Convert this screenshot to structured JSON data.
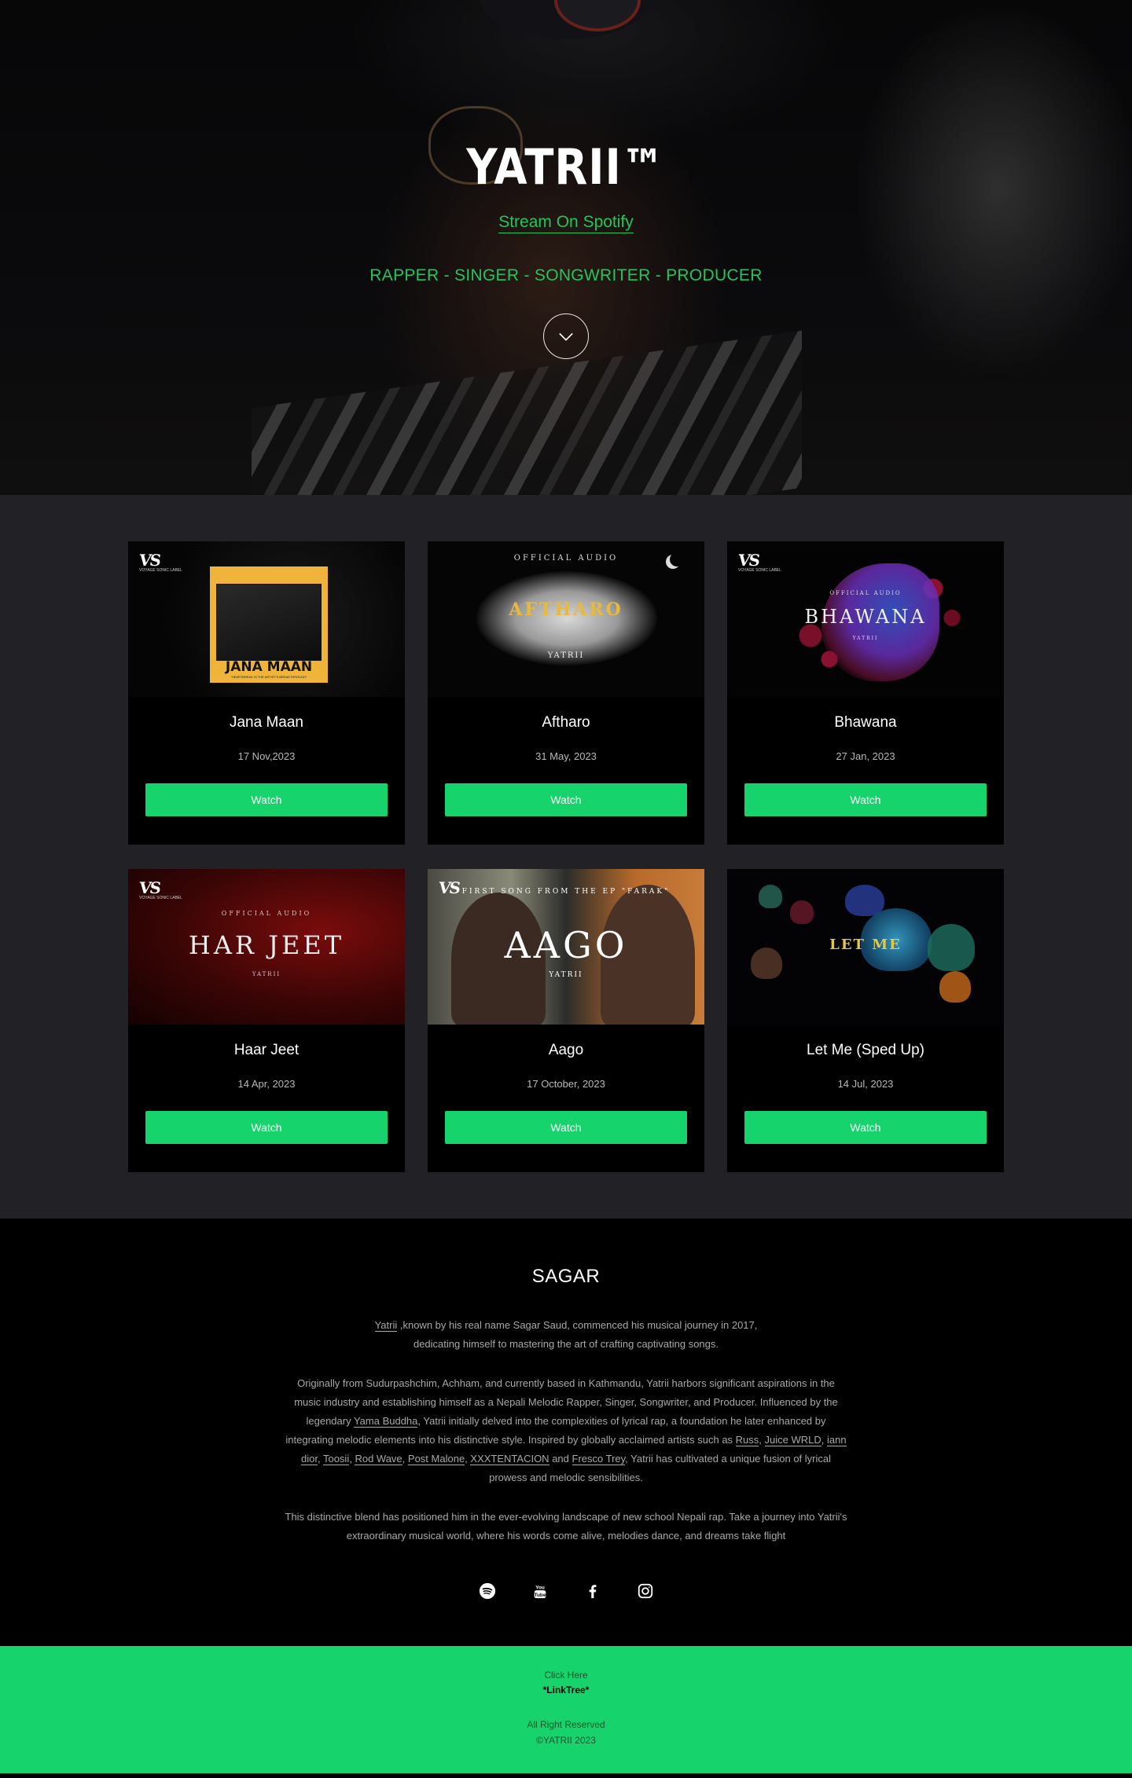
{
  "hero": {
    "title": "YATRII™",
    "spotify_link": "Stream On Spotify",
    "roles": "RAPPER - SINGER - SONGWRITER - PRODUCER",
    "scroll_icon": "chevron-down-icon"
  },
  "cards": [
    {
      "title": "Jana Maan",
      "date": "17 Nov,2023",
      "button": "Watch",
      "thumb": {
        "logo": "VS",
        "logo_sub": "VOYAGE SONIC LABEL",
        "poster_title": "JANA MAAN",
        "poster_caption": "\"HEARTBREAK IS THE ARTIST'S BREAKTHROUGH\""
      }
    },
    {
      "title": "Aftharo",
      "date": "31 May, 2023",
      "button": "Watch",
      "thumb": {
        "overline": "OFFICIAL AUDIO",
        "title": "AFTHARO",
        "artist": "YATRII"
      }
    },
    {
      "title": "Bhawana",
      "date": "27 Jan, 2023",
      "button": "Watch",
      "thumb": {
        "logo": "VS",
        "logo_sub": "VOYAGE SONIC LABEL",
        "overline": "OFFICIAL AUDIO",
        "title": "BHAWANA",
        "artist": "YATRII"
      }
    },
    {
      "title": "Haar Jeet",
      "date": "14 Apr, 2023",
      "button": "Watch",
      "thumb": {
        "logo": "VS",
        "logo_sub": "VOYAGE SONIC LABEL",
        "overline": "OFFICIAL AUDIO",
        "title": "HAR JEET",
        "artist": "YATRII"
      }
    },
    {
      "title": "Aago",
      "date": "17 October, 2023",
      "button": "Watch",
      "thumb": {
        "logo": "VS",
        "overline": "FIRST SONG FROM THE EP \"FARAK\"",
        "title": "AAGO",
        "artist": "YATRII"
      }
    },
    {
      "title": "Let Me (Sped Up)",
      "date": "14 Jul, 2023",
      "button": "Watch",
      "thumb": {
        "title": "LET ME"
      }
    }
  ],
  "about": {
    "title": "SAGAR",
    "p1_link": "Yatrii",
    "p1_rest": " ,known by his real name Sagar Saud, commenced his musical journey in 2017, dedicating himself to mastering the art of crafting captivating songs.",
    "p2_a": "Originally from Sudurpashchim, Achham, and currently based in Kathmandu, Yatrii harbors significant aspirations in the music industry and establishing himself as a Nepali Melodic Rapper, Singer, Songwriter, and Producer. Influenced by the legendary ",
    "p2_link1": "Yama Buddha",
    "p2_b": ", Yatrii initially delved into the complexities of lyrical rap, a foundation he later enhanced by integrating melodic elements into his distinctive style. Inspired by globally acclaimed artists such as ",
    "artists": [
      "Russ",
      "Juice WRLD",
      "iann dior",
      "Toosii",
      "Rod Wave",
      "Post Malone",
      "XXXTENTACION",
      "Fresco Trey"
    ],
    "and": " and ",
    "p2_c": ", Yatrii has cultivated a unique fusion of lyrical prowess and melodic sensibilities.",
    "p3": "This distinctive blend has positioned him in the ever-evolving landscape of new school Nepali rap. Take a journey into Yatrii's extraordinary musical world, where his words come alive, melodies dance, and dreams take flight",
    "socials": [
      "spotify-icon",
      "youtube-icon",
      "facebook-icon",
      "instagram-icon"
    ]
  },
  "footer": {
    "click": "Click Here",
    "link": "*LinkTree*",
    "rights": "All Right Reserved",
    "copy": "©YATRII 2023"
  },
  "colors": {
    "accent": "#16d46b",
    "section_bg": "#222226",
    "card_bg": "#000000"
  }
}
